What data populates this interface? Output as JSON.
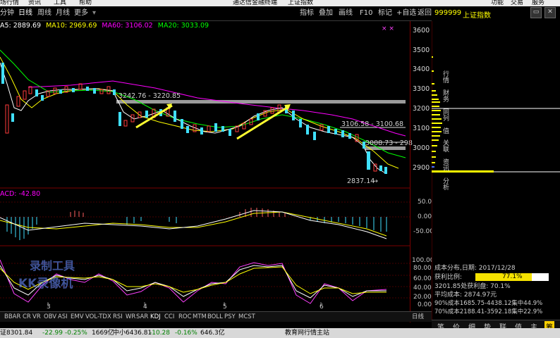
{
  "menubar": {
    "items": [
      "场行情",
      "资讯",
      "工具",
      "帮助"
    ],
    "title": "通达信金融终端",
    "index_title": "上证指数",
    "right": [
      "功能",
      "交易",
      "服务"
    ]
  },
  "toolbar": {
    "left": [
      "分钟",
      "日线",
      "周线",
      "月线",
      "更多"
    ],
    "right": [
      "指标",
      "叠加",
      "画线",
      "F10",
      "标记",
      "+自选",
      "返回"
    ]
  },
  "stock_header": {
    "code": "999999",
    "name": "上证指数"
  },
  "ma_line": {
    "ma5": "A5: 2889.69",
    "ma10": "MA10: 2969.69",
    "ma60": "MA60: 3106.02",
    "ma20": "MA20: 3033.09"
  },
  "price_labels": {
    "a": "3242.76 - 3220.85",
    "b": "3106.58 - 3100.68",
    "c": "3008.73 - 298",
    "low": "2837.14"
  },
  "axis_main": [
    "3600",
    "3500",
    "3400",
    "3300",
    "3200",
    "3100",
    "3000",
    "2900"
  ],
  "macd_label": "ACD: -42.80",
  "axis_macd": [
    "50.00",
    "0.00",
    "-50.00"
  ],
  "axis_kdj": [
    "100.00",
    "80.00",
    "60.00",
    "40.00",
    "20.00",
    "0.00"
  ],
  "x_ticks": [
    "3",
    "4",
    "5",
    "6"
  ],
  "watermark": {
    "line1": "录制工具",
    "line2": "KK录像机"
  },
  "cost": {
    "title": "成本分布,日期: 2017/12/28",
    "profit_label": "获利比例:",
    "profit_value": "77.1%",
    "line3": "3201.85处获利盘: 70.1%",
    "line4": "平均成本: 2874.97元",
    "line5": "90%成本1685.75-4438.12集中44.9%",
    "line6": "70%成本2188.41-3592.18集中22.9%"
  },
  "side_vertical": [
    "行情",
    "财务",
    "同列",
    "值",
    "关联",
    "资讯",
    "分析"
  ],
  "bottom_tabs": [
    "BBAR",
    "CR",
    "VR",
    "OBV",
    "ASI",
    "EMV",
    "VOL-TDX",
    "RSI",
    "WR",
    "SAR",
    "KDJ",
    "CCI",
    "ROC",
    "MTM",
    "BOLL",
    "PSY",
    "MCST"
  ],
  "bottom_period": "日线",
  "right_bottom": [
    "笔",
    "价",
    "细",
    "势",
    "联",
    "值",
    "主",
    "筹"
  ],
  "status": {
    "s1": "证8301.84",
    "s2": "-22.99",
    "s3": "-0.25%",
    "s4": "1669亿",
    "s5": "中小6436.81",
    "s6": "-10.28",
    "s7": "-0.16%",
    "s8": "646.3亿",
    "s9": "教育网行情主站"
  },
  "colors": {
    "up": "#ff3c3c",
    "down": "#40e0ff",
    "ma5": "#ffffff",
    "ma10": "#ffff00",
    "ma20": "#00ff00",
    "ma60": "#ff00ff",
    "arrow": "#ffff30"
  }
}
